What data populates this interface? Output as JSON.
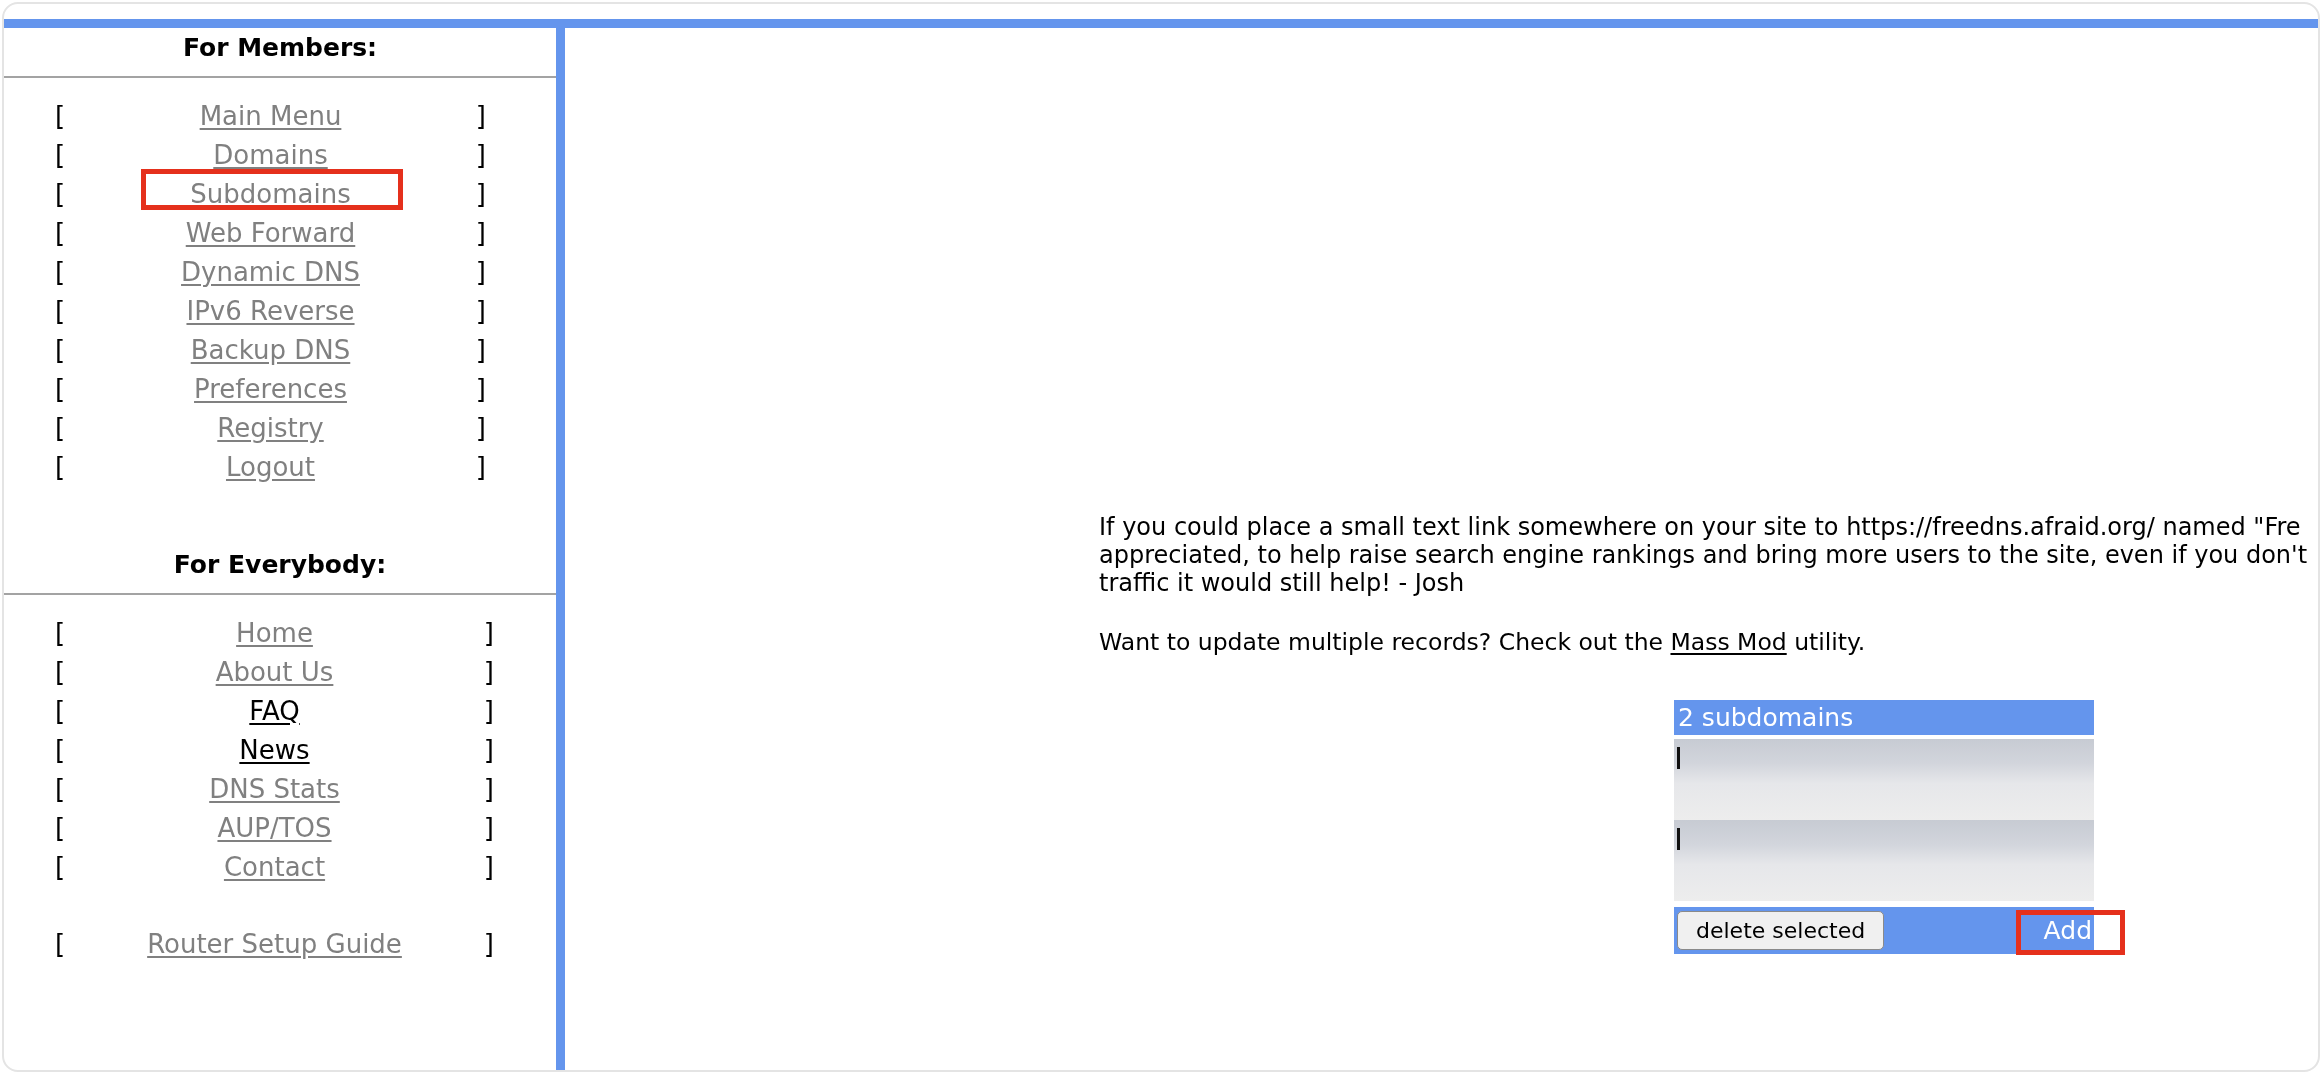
{
  "sidebar": {
    "sections": [
      {
        "heading": "For Members:",
        "groups": [
          {
            "items": [
              {
                "open": "[",
                "label": "Main Menu",
                "close": "]",
                "visited": false,
                "highlighted": false
              },
              {
                "open": "[",
                "label": "Domains",
                "close": "]",
                "visited": false,
                "highlighted": false
              },
              {
                "open": "[",
                "label": "Subdomains",
                "close": "]",
                "visited": false,
                "highlighted": true
              },
              {
                "open": "[",
                "label": "Web Forward",
                "close": "]",
                "visited": false,
                "highlighted": false
              },
              {
                "open": "[",
                "label": "Dynamic DNS",
                "close": "]",
                "visited": false,
                "highlighted": false
              },
              {
                "open": "[",
                "label": "IPv6 Reverse",
                "close": "]",
                "visited": false,
                "highlighted": false
              },
              {
                "open": "[",
                "label": "Backup DNS",
                "close": "]",
                "visited": false,
                "highlighted": false
              },
              {
                "open": "[",
                "label": "Preferences",
                "close": "]",
                "visited": false,
                "highlighted": false
              },
              {
                "open": "[",
                "label": "Registry",
                "close": "]",
                "visited": false,
                "highlighted": false
              },
              {
                "open": "[",
                "label": "Logout",
                "close": "]",
                "visited": false,
                "highlighted": false
              }
            ]
          }
        ]
      },
      {
        "heading": "For Everybody:",
        "groups": [
          {
            "items": [
              {
                "open": "[",
                "label": "Home",
                "close": "]",
                "visited": false,
                "highlighted": false
              },
              {
                "open": "[",
                "label": "About Us",
                "close": "]",
                "visited": false,
                "highlighted": false
              },
              {
                "open": "[",
                "label": "FAQ",
                "close": "]",
                "visited": true,
                "highlighted": false
              },
              {
                "open": "[",
                "label": "News",
                "close": "]",
                "visited": true,
                "highlighted": false
              },
              {
                "open": "[",
                "label": "DNS Stats",
                "close": "]",
                "visited": false,
                "highlighted": false
              },
              {
                "open": "[",
                "label": "AUP/TOS",
                "close": "]",
                "visited": false,
                "highlighted": false
              },
              {
                "open": "[",
                "label": "Contact",
                "close": "]",
                "visited": false,
                "highlighted": false
              }
            ]
          },
          {
            "items": [
              {
                "open": "[",
                "label": "Router Setup Guide",
                "close": "]",
                "visited": false,
                "highlighted": false
              }
            ]
          }
        ]
      }
    ]
  },
  "main": {
    "notice_lines": [
      "If you could place a small text link somewhere on your site to https://freedns.afraid.org/ named \"Fre",
      "appreciated, to help raise search engine rankings and bring more users to the site, even if you don't",
      "traffic it would still help! - Josh"
    ],
    "mass_mod": {
      "before": "Want to update multiple records? Check out the",
      "link": "Mass Mod",
      "after": "utility."
    }
  },
  "subdomains_table": {
    "title": "2 subdomains",
    "rows": [
      {
        "kind": "blurred"
      },
      {
        "kind": "blurred"
      }
    ],
    "delete_button": "delete selected",
    "add_button": {
      "label": "Add",
      "highlighted": true
    }
  }
}
